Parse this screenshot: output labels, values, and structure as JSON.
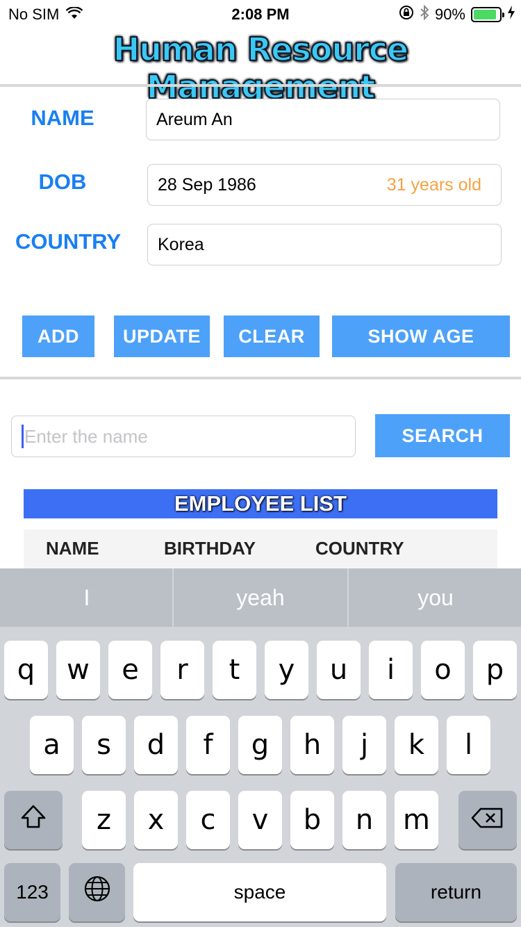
{
  "status_bar": {
    "carrier": "No SIM",
    "time": "2:08 PM",
    "battery": "90%",
    "battery_level": 0.9,
    "icons": [
      "wifi-icon",
      "rotation-lock-icon",
      "bluetooth-icon",
      "battery-icon",
      "charging-icon"
    ]
  },
  "header": {
    "title": "Human Resource Management"
  },
  "form": {
    "name_label": "NAME",
    "name_value": "Areum An",
    "dob_label": "DOB",
    "dob_value": "28 Sep 1986",
    "age_text": "31 years old",
    "country_label": "COUNTRY",
    "country_value": "Korea"
  },
  "buttons": {
    "add": "ADD",
    "update": "UPDATE",
    "clear": "CLEAR",
    "show_age": "SHOW AGE"
  },
  "search": {
    "placeholder": "Enter the name",
    "button": "SEARCH"
  },
  "employee_list": {
    "title": "EMPLOYEE LIST",
    "columns": [
      "NAME",
      "BIRTHDAY",
      "COUNTRY"
    ]
  },
  "keyboard": {
    "suggestions": [
      "I",
      "yeah",
      "you"
    ],
    "row1": [
      "q",
      "w",
      "e",
      "r",
      "t",
      "y",
      "u",
      "i",
      "o",
      "p"
    ],
    "row2": [
      "a",
      "s",
      "d",
      "f",
      "g",
      "h",
      "j",
      "k",
      "l"
    ],
    "row3": [
      "z",
      "x",
      "c",
      "v",
      "b",
      "n",
      "m"
    ],
    "numbers": "123",
    "space": "space",
    "return": "return"
  },
  "colors": {
    "accent": "#1a7ff2",
    "button": "#4da1f8",
    "list_header": "#3d6ff5",
    "age": "#f5a244"
  }
}
